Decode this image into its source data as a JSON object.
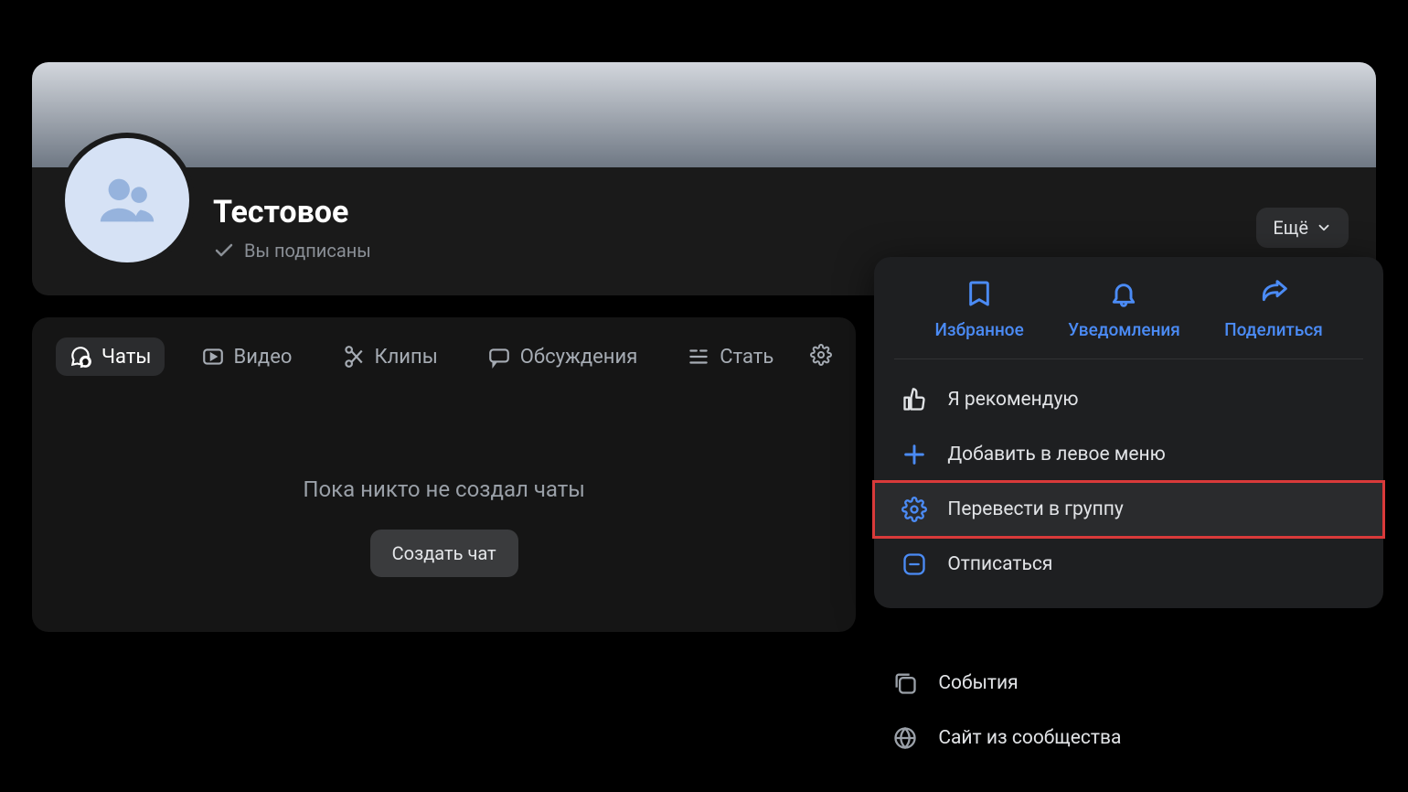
{
  "header": {
    "title": "Тестовое",
    "subscribed_label": "Вы подписаны",
    "more_label": "Ещё"
  },
  "tabs": {
    "chats": "Чаты",
    "video": "Видео",
    "clips": "Клипы",
    "discussions": "Обсуждения",
    "articles": "Стать"
  },
  "empty": {
    "text": "Пока никто не создал чаты",
    "button": "Создать чат"
  },
  "dropdown": {
    "top": {
      "favorites": "Избранное",
      "notifications": "Уведомления",
      "share": "Поделиться"
    },
    "items": {
      "recommend": "Я рекомендую",
      "add_left_menu": "Добавить в левое меню",
      "convert_group": "Перевести в группу",
      "unsubscribe": "Отписаться"
    }
  },
  "below": {
    "events": "События",
    "site": "Сайт из сообщества"
  }
}
